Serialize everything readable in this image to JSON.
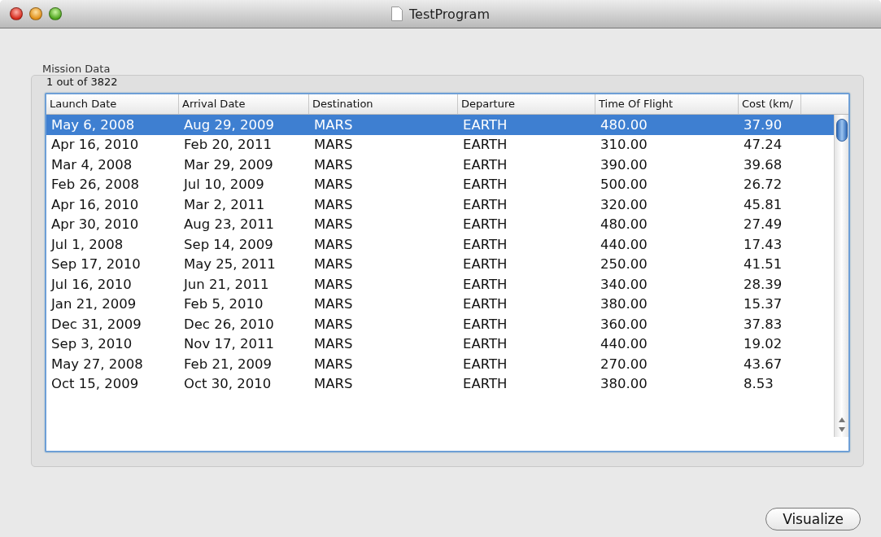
{
  "window": {
    "title": "TestProgram"
  },
  "group": {
    "title": "Mission Data",
    "status": "1 out of 3822"
  },
  "table": {
    "columns": [
      "Launch Date",
      "Arrival Date",
      "Destination",
      "Departure",
      "Time Of Flight",
      "Cost (km/"
    ],
    "rows": [
      {
        "selected": true,
        "cells": [
          "May 6, 2008",
          "Aug 29, 2009",
          "MARS",
          "EARTH",
          "480.00",
          "37.90"
        ]
      },
      {
        "selected": false,
        "cells": [
          "Apr 16, 2010",
          "Feb 20, 2011",
          "MARS",
          "EARTH",
          "310.00",
          "47.24"
        ]
      },
      {
        "selected": false,
        "cells": [
          "Mar 4, 2008",
          "Mar 29, 2009",
          "MARS",
          "EARTH",
          "390.00",
          "39.68"
        ]
      },
      {
        "selected": false,
        "cells": [
          "Feb 26, 2008",
          "Jul 10, 2009",
          "MARS",
          "EARTH",
          "500.00",
          "26.72"
        ]
      },
      {
        "selected": false,
        "cells": [
          "Apr 16, 2010",
          "Mar 2, 2011",
          "MARS",
          "EARTH",
          "320.00",
          "45.81"
        ]
      },
      {
        "selected": false,
        "cells": [
          "Apr 30, 2010",
          "Aug 23, 2011",
          "MARS",
          "EARTH",
          "480.00",
          "27.49"
        ]
      },
      {
        "selected": false,
        "cells": [
          "Jul 1, 2008",
          "Sep 14, 2009",
          "MARS",
          "EARTH",
          "440.00",
          "17.43"
        ]
      },
      {
        "selected": false,
        "cells": [
          "Sep 17, 2010",
          "May 25, 2011",
          "MARS",
          "EARTH",
          "250.00",
          "41.51"
        ]
      },
      {
        "selected": false,
        "cells": [
          "Jul 16, 2010",
          "Jun 21, 2011",
          "MARS",
          "EARTH",
          "340.00",
          "28.39"
        ]
      },
      {
        "selected": false,
        "cells": [
          "Jan 21, 2009",
          "Feb 5, 2010",
          "MARS",
          "EARTH",
          "380.00",
          "15.37"
        ]
      },
      {
        "selected": false,
        "cells": [
          "Dec 31, 2009",
          "Dec 26, 2010",
          "MARS",
          "EARTH",
          "360.00",
          "37.83"
        ]
      },
      {
        "selected": false,
        "cells": [
          "Sep 3, 2010",
          "Nov 17, 2011",
          "MARS",
          "EARTH",
          "440.00",
          "19.02"
        ]
      },
      {
        "selected": false,
        "cells": [
          "May 27, 2008",
          "Feb 21, 2009",
          "MARS",
          "EARTH",
          "270.00",
          "43.67"
        ]
      },
      {
        "selected": false,
        "cells": [
          "Oct 15, 2009",
          "Oct 30, 2010",
          "MARS",
          "EARTH",
          "380.00",
          "8.53"
        ]
      }
    ]
  },
  "buttons": [
    "Visualize"
  ]
}
